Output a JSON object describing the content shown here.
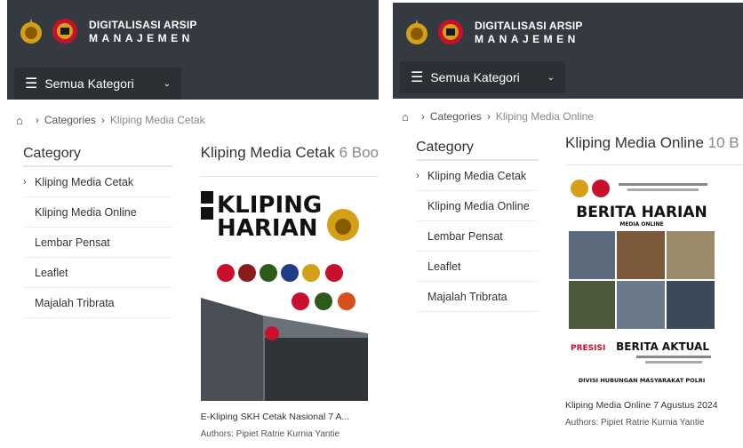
{
  "brand": {
    "line1": "DIGITALISASI ARSIP",
    "line2": "MANAJEMEN"
  },
  "nav": {
    "category_button": "Semua Kategori"
  },
  "left": {
    "breadcrumb": [
      "Categories",
      "Kliping Media Cetak"
    ],
    "sidebar_title": "Category",
    "sidebar_items": [
      "Kliping Media Cetak",
      "Kliping Media Online",
      "Lembar Pensat",
      "Leaflet",
      "Majalah Tribrata"
    ],
    "main_title": "Kliping Media Cetak",
    "main_count": "6 Boo",
    "card": {
      "cover_line1": "KLIPING",
      "cover_line2": "HARIAN",
      "title": "E-Kliping SKH Cetak Nasional 7 A...",
      "author": "Authors: Pipiet Ratrie Kurnia Yantie"
    }
  },
  "right": {
    "breadcrumb": [
      "Categories",
      "Kliping Media Online"
    ],
    "sidebar_title": "Category",
    "sidebar_items": [
      "Kliping Media Cetak",
      "Kliping Media Online",
      "Lembar Pensat",
      "Leaflet",
      "Majalah Tribrata"
    ],
    "main_title": "Kliping Media Online",
    "main_count": "10 B",
    "card": {
      "cover_title": "BERITA HARIAN",
      "cover_sub": "MEDIA ONLINE",
      "cover_banner": "BERITA AKTUAL",
      "cover_footer": "DIVISI HUBUNGAN MASYARAKAT POLRI",
      "cover_presisi": "PRESISI",
      "title": "Kliping Media Online 7 Agustus 2024",
      "author": "Authors: Pipiet Ratrie Kurnia Yantie"
    }
  },
  "colors": {
    "header": "#343a40",
    "button": "#2b3035",
    "accent_red": "#c8102e",
    "gold": "#d4a017"
  }
}
